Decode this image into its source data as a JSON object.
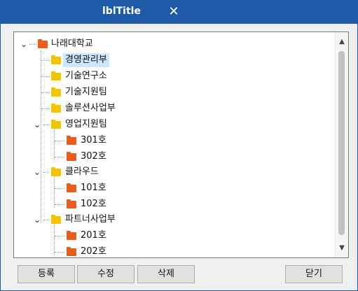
{
  "window": {
    "title": "lblTitle"
  },
  "colors": {
    "titlebar": "#1e5aa8",
    "folder_red": "#e85d1e",
    "folder_yellow": "#f5c400",
    "selection": "#cce8ff"
  },
  "tree": {
    "root": "나래대학교",
    "nodes": [
      "경영관리부",
      "기술연구소",
      "기술지원팀",
      "솔루션사업부",
      "영업지원팀",
      "301호",
      "302호",
      "클라우드",
      "101호",
      "102호",
      "파트너사업부",
      "201호",
      "202호"
    ]
  },
  "buttons": {
    "register": "등록",
    "edit": "수정",
    "delete": "삭제",
    "close": "닫기"
  }
}
